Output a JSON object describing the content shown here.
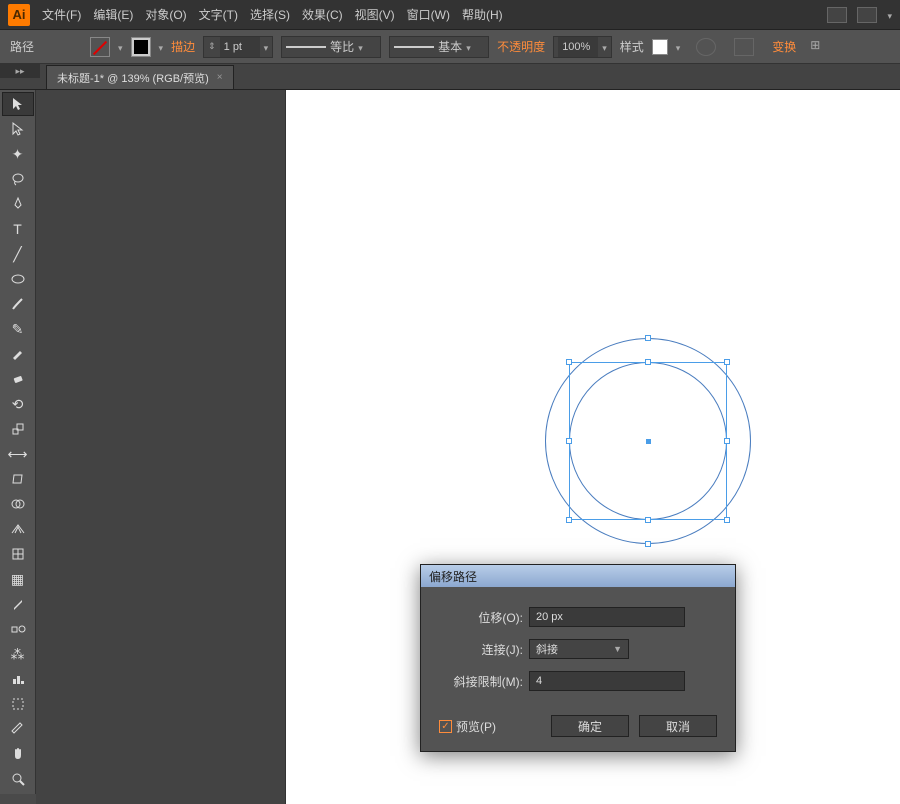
{
  "app": {
    "logo": "Ai"
  },
  "menu": {
    "file": "文件(F)",
    "edit": "编辑(E)",
    "object": "对象(O)",
    "type": "文字(T)",
    "select": "选择(S)",
    "effect": "效果(C)",
    "view": "视图(V)",
    "window": "窗口(W)",
    "help": "帮助(H)"
  },
  "controlbar": {
    "selection": "路径",
    "stroke": "描边",
    "stroke_weight": "1 pt",
    "profile": "等比",
    "brush": "基本",
    "opacity_label": "不透明度",
    "opacity_value": "100%",
    "style_label": "样式",
    "transform": "变换"
  },
  "tab": {
    "title": "未标题-1* @ 139% (RGB/预览)"
  },
  "dialog": {
    "title": "偏移路径",
    "offset_label": "位移(O):",
    "offset_value": "20 px",
    "join_label": "连接(J):",
    "join_value": "斜接",
    "miter_label": "斜接限制(M):",
    "miter_value": "4",
    "preview": "预览(P)",
    "ok": "确定",
    "cancel": "取消"
  }
}
